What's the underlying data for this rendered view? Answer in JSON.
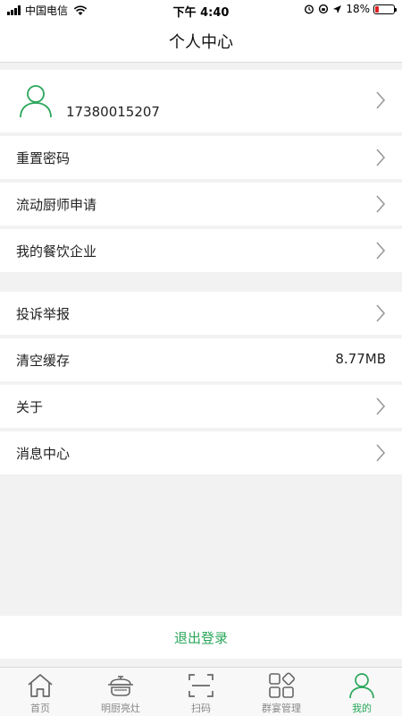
{
  "status": {
    "carrier": "中国电信",
    "time": "下午 4:40",
    "battery": "18%",
    "battery_level": 0.18
  },
  "header": {
    "title": "个人中心"
  },
  "profile": {
    "phone": "17380015207"
  },
  "menu": {
    "reset_password": "重置密码",
    "mobile_chef": "流动厨师申请",
    "my_company": "我的餐饮企业",
    "complaint": "投诉举报",
    "clear_cache": "清空缓存",
    "cache_size": "8.77MB",
    "about": "关于",
    "messages": "消息中心"
  },
  "logout": {
    "label": "退出登录"
  },
  "tabs": [
    {
      "label": "首页",
      "icon": "home-icon"
    },
    {
      "label": "明厨亮灶",
      "icon": "pot-icon"
    },
    {
      "label": "扫码",
      "icon": "scan-icon"
    },
    {
      "label": "群宴管理",
      "icon": "grid-icon"
    },
    {
      "label": "我的",
      "icon": "user-icon",
      "active": true
    }
  ],
  "colors": {
    "accent": "#2aa65a",
    "battery_low": "#e02020",
    "background": "#f2f2f2"
  }
}
